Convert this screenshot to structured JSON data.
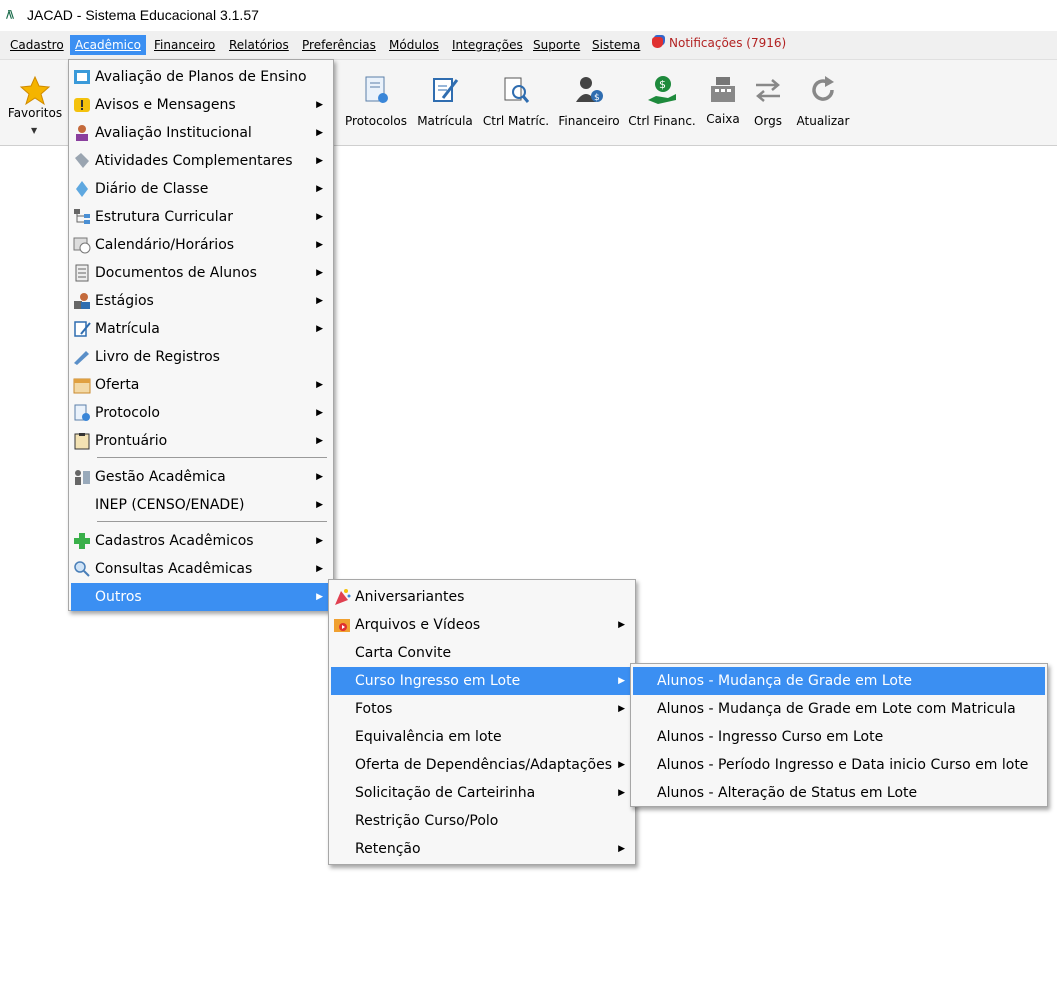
{
  "window": {
    "title": "JACAD - Sistema Educacional 3.1.57"
  },
  "menubar": {
    "items": [
      "Cadastro",
      "Acadêmico",
      "Financeiro",
      "Relatórios",
      "Preferências",
      "Módulos",
      "Integrações",
      "Suporte",
      "Sistema"
    ],
    "active": "Acadêmico",
    "notifications": "Notificações (7916)"
  },
  "toolbar": {
    "favoritos": "Favoritos",
    "buttons": [
      "Protocolos",
      "Matrícula",
      "Ctrl Matríc.",
      "Financeiro",
      "Ctrl Financ.",
      "Caixa",
      "Orgs",
      "Atualizar"
    ]
  },
  "academico_menu": {
    "items": [
      {
        "label": "Avaliação de Planos de Ensino",
        "icon": "plan-icon",
        "submenu": false
      },
      {
        "label": "Avisos e Mensagens",
        "icon": "warning-icon",
        "submenu": true
      },
      {
        "label": "Avaliação Institucional",
        "icon": "person-icon",
        "submenu": true
      },
      {
        "label": "Atividades Complementares",
        "icon": "tag-icon",
        "submenu": true
      },
      {
        "label": "Diário de Classe",
        "icon": "diamond-icon",
        "submenu": true
      },
      {
        "label": "Estrutura Curricular",
        "icon": "tree-icon",
        "submenu": true
      },
      {
        "label": "Calendário/Horários",
        "icon": "calendar-clock-icon",
        "submenu": true
      },
      {
        "label": "Documentos de Alunos",
        "icon": "document-icon",
        "submenu": true
      },
      {
        "label": "Estágios",
        "icon": "intern-icon",
        "submenu": true
      },
      {
        "label": "Matrícula",
        "icon": "edit-icon",
        "submenu": true
      },
      {
        "label": "Livro de Registros",
        "icon": "pen-icon",
        "submenu": false
      },
      {
        "label": "Oferta",
        "icon": "calendar-icon",
        "submenu": true
      },
      {
        "label": "Protocolo",
        "icon": "protocol-icon",
        "submenu": true
      },
      {
        "label": "Prontuário",
        "icon": "clipboard-icon",
        "submenu": true
      },
      {
        "label": "Gestão Acadêmica",
        "icon": "management-icon",
        "submenu": true
      },
      {
        "label": "INEP (CENSO/ENADE)",
        "icon": "",
        "submenu": true
      },
      {
        "label": "Cadastros Acadêmicos",
        "icon": "plus-icon",
        "submenu": true
      },
      {
        "label": "Consultas Acadêmicas",
        "icon": "search-icon",
        "submenu": true
      },
      {
        "label": "Outros",
        "icon": "",
        "submenu": true
      }
    ]
  },
  "outros_menu": {
    "items": [
      {
        "label": "Aniversariantes",
        "icon": "party-icon",
        "submenu": false
      },
      {
        "label": "Arquivos e Vídeos",
        "icon": "video-icon",
        "submenu": true
      },
      {
        "label": "Carta Convite",
        "icon": "",
        "submenu": false
      },
      {
        "label": "Curso Ingresso em Lote",
        "icon": "",
        "submenu": true
      },
      {
        "label": "Fotos",
        "icon": "",
        "submenu": true
      },
      {
        "label": "Equivalência em lote",
        "icon": "",
        "submenu": false
      },
      {
        "label": "Oferta de Dependências/Adaptações",
        "icon": "",
        "submenu": true
      },
      {
        "label": "Solicitação de Carteirinha",
        "icon": "",
        "submenu": true
      },
      {
        "label": "Restrição Curso/Polo",
        "icon": "",
        "submenu": false
      },
      {
        "label": "Retenção",
        "icon": "",
        "submenu": true
      }
    ]
  },
  "lote_menu": {
    "items": [
      "Alunos - Mudança de Grade em Lote",
      "Alunos - Mudança de Grade em Lote com Matricula",
      "Alunos - Ingresso Curso em Lote",
      "Alunos - Período Ingresso e Data inicio Curso em lote",
      "Alunos - Alteração de Status em Lote"
    ]
  },
  "colors": {
    "highlight": "#3b8ff2",
    "menu_bg": "#f7f7f7",
    "notification": "#b22222"
  }
}
